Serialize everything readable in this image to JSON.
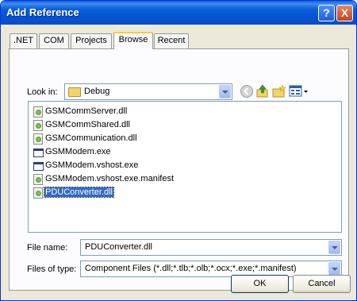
{
  "window": {
    "title": "Add Reference"
  },
  "titlebar_buttons": {
    "help": "?",
    "close": "X"
  },
  "tabs": [
    {
      "label": ".NET",
      "active": false
    },
    {
      "label": "COM",
      "active": false
    },
    {
      "label": "Projects",
      "active": false
    },
    {
      "label": "Browse",
      "active": true
    },
    {
      "label": "Recent",
      "active": false
    }
  ],
  "look_in": {
    "label": "Look in:",
    "value": "Debug"
  },
  "files": [
    {
      "name": "GSMCommServer.dll",
      "icon": "dll-file-icon",
      "selected": false
    },
    {
      "name": "GSMCommShared.dll",
      "icon": "dll-file-icon",
      "selected": false
    },
    {
      "name": "GSMCommunication.dll",
      "icon": "dll-file-icon",
      "selected": false
    },
    {
      "name": "GSMModem.exe",
      "icon": "exe-file-icon",
      "selected": false
    },
    {
      "name": "GSMModem.vshost.exe",
      "icon": "exe-file-icon",
      "selected": false
    },
    {
      "name": "GSMModem.vshost.exe.manifest",
      "icon": "manifest-file-icon",
      "selected": false
    },
    {
      "name": "PDUConverter.dll",
      "icon": "dll-file-icon",
      "selected": true
    }
  ],
  "file_name": {
    "label": "File name:",
    "value": "PDUConverter.dll"
  },
  "files_of_type": {
    "label": "Files of type:",
    "value": "Component Files (*.dll;*.tlb;*.olb;*.ocx;*.exe;*.manifest)"
  },
  "buttons": {
    "ok": "OK",
    "cancel": "Cancel"
  },
  "colors": {
    "title_bar": "#0a5fd8",
    "selection": "#316ac5",
    "dialog_bg": "#ece9d8"
  }
}
